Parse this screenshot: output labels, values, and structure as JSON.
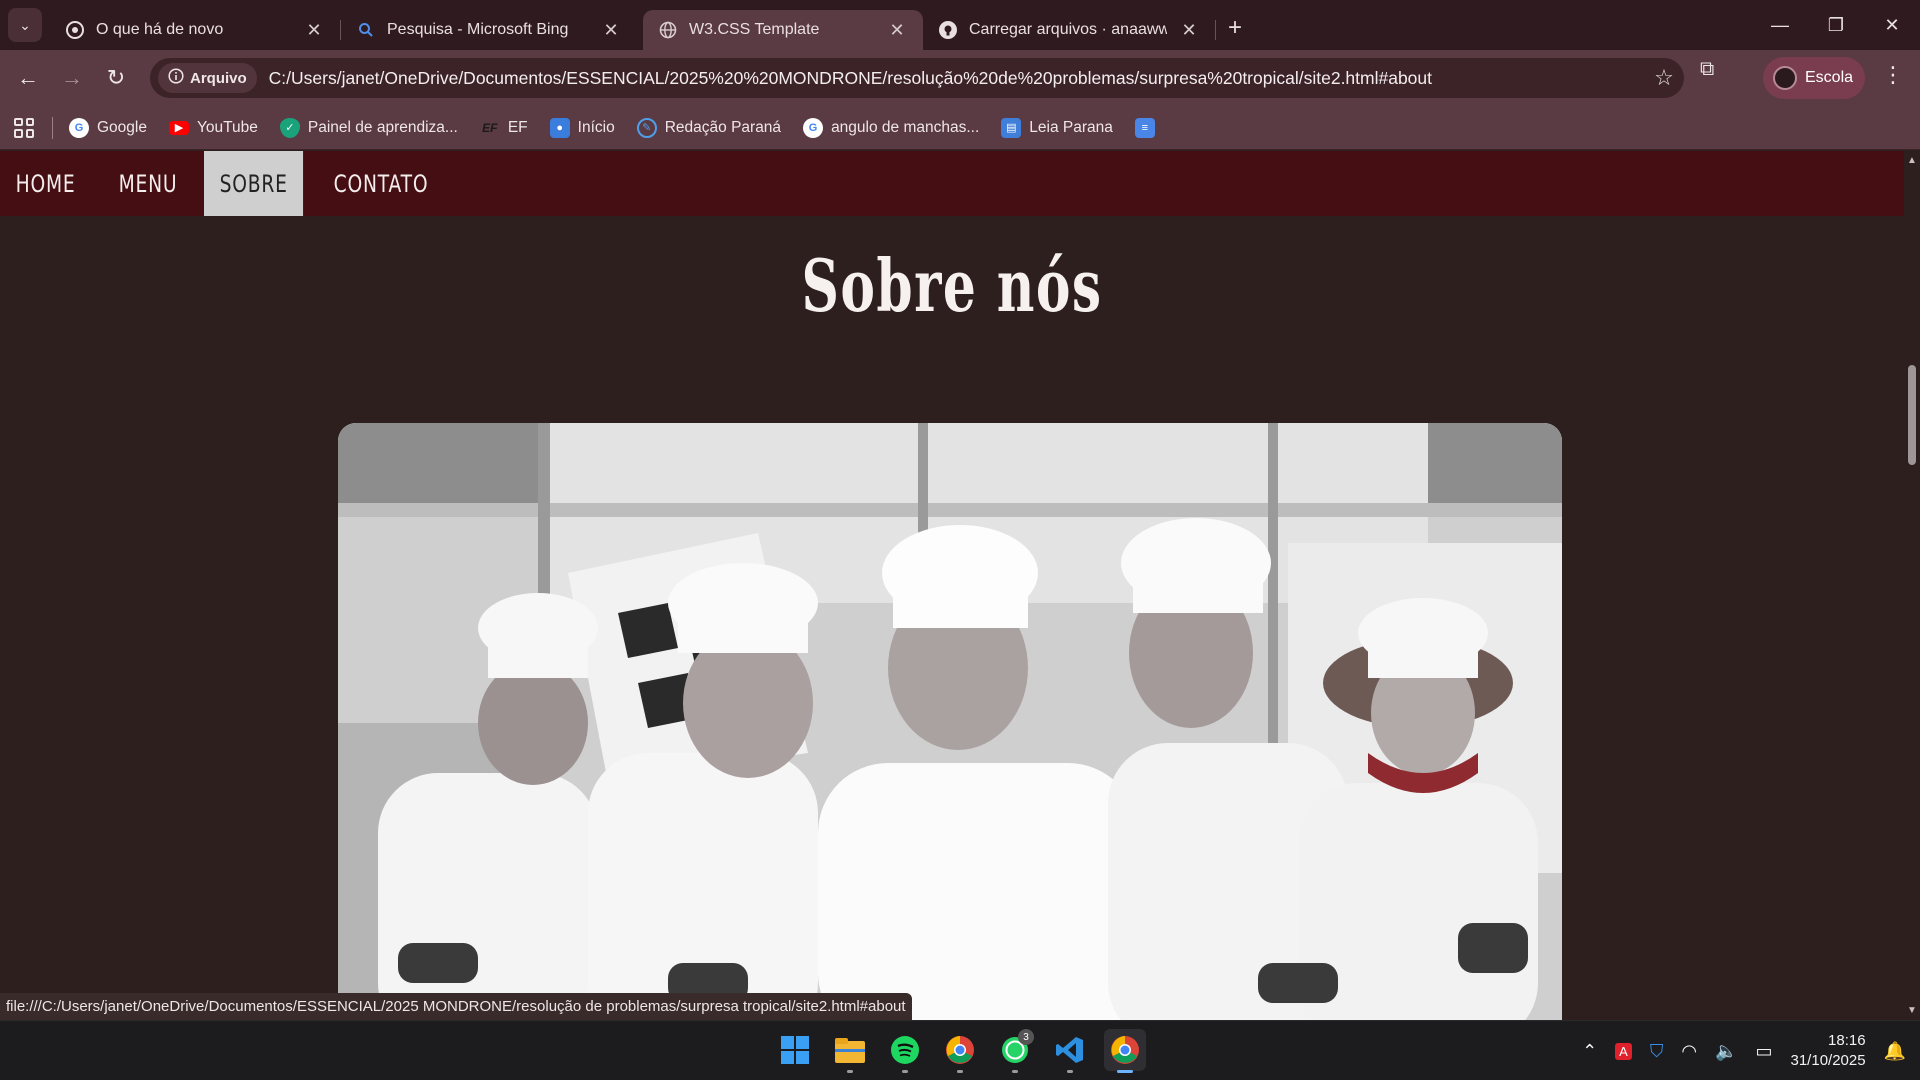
{
  "browser": {
    "tabs": [
      {
        "title": "O que há de novo",
        "active": false
      },
      {
        "title": "Pesquisa - Microsoft Bing",
        "active": false
      },
      {
        "title": "W3.CSS Template",
        "active": true
      },
      {
        "title": "Carregar arquivos · anaawwx/tr",
        "active": false
      }
    ],
    "address": {
      "chip_label": "Arquivo",
      "url": "C:/Users/janet/OneDrive/Documentos/ESSENCIAL/2025%20%20MONDRONE/resolução%20de%20problemas/surpresa%20tropical/site2.html#about"
    },
    "profile_label": "Escola",
    "bookmarks": [
      {
        "label": "Google",
        "icon": "google-icon"
      },
      {
        "label": "YouTube",
        "icon": "youtube-icon"
      },
      {
        "label": "Painel de aprendiza...",
        "icon": "check-shield-icon"
      },
      {
        "label": "EF",
        "icon": "ef-icon"
      },
      {
        "label": "Início",
        "icon": "contacts-icon"
      },
      {
        "label": "Redação Paraná",
        "icon": "redacao-icon"
      },
      {
        "label": "angulo de manchas...",
        "icon": "google-icon"
      },
      {
        "label": "Leia Parana",
        "icon": "book-icon"
      },
      {
        "label": "",
        "icon": "docs-icon"
      }
    ],
    "status_url": "file:///C:/Users/janet/OneDrive/Documentos/ESSENCIAL/2025  MONDRONE/resolução de problemas/surpresa tropical/site2.html#about"
  },
  "site": {
    "nav": [
      {
        "label": "HOME",
        "active": false
      },
      {
        "label": "MENU",
        "active": false
      },
      {
        "label": "SOBRE",
        "active": true
      },
      {
        "label": "CONTATO",
        "active": false
      }
    ],
    "heading": "Sobre nós"
  },
  "taskbar": {
    "apps": [
      "windows-start-icon",
      "file-explorer-icon",
      "spotify-icon",
      "chrome-icon",
      "whatsapp-icon",
      "vscode-icon",
      "chrome-active-icon"
    ],
    "whatsapp_badge": "3",
    "time": "18:16",
    "date": "31/10/2025"
  },
  "colors": {
    "site_nav_bg": "#440e12",
    "page_bg": "#2d1f1e",
    "browser_frame": "#5a3a43",
    "active_nav_bg": "#cfcfcf"
  }
}
